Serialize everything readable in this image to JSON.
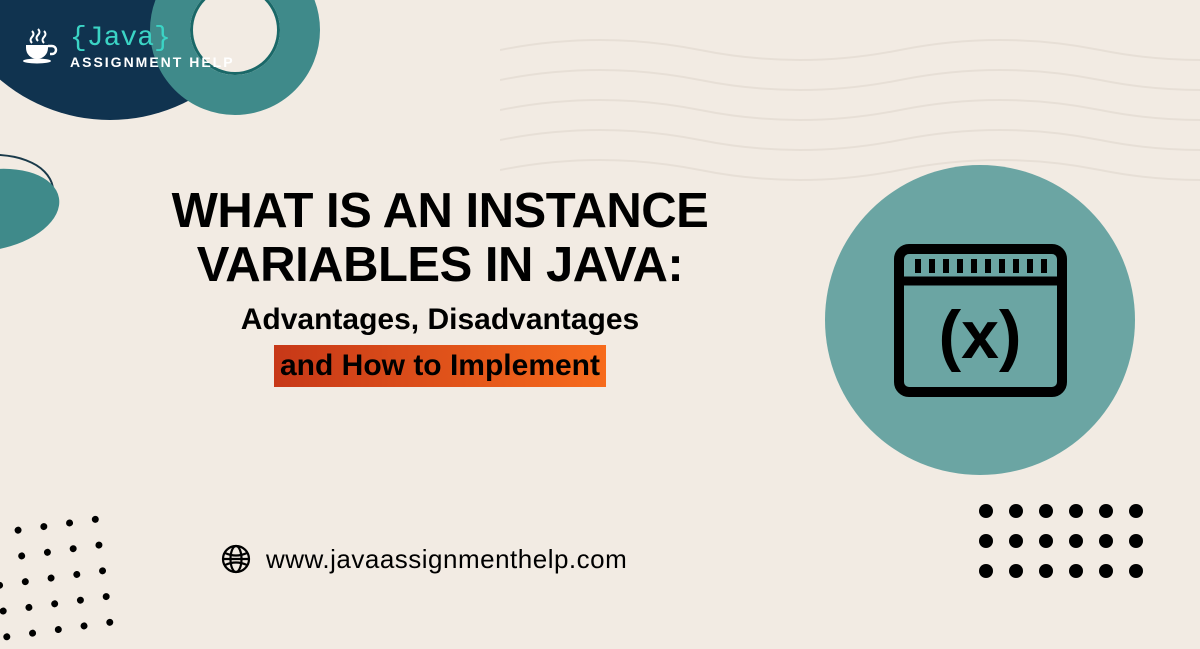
{
  "logo": {
    "name": "{Java}",
    "tagline": "ASSIGNMENT HELP"
  },
  "heading": {
    "line1": "WHAT IS AN INSTANCE",
    "line2": "VARIABLES IN JAVA:",
    "sub": "Advantages, Disadvantages",
    "highlight": "and How to Implement"
  },
  "website": {
    "url": "www.javaassignmenthelp.com"
  },
  "icons": {
    "cup": "coffee-cup-icon",
    "globe": "globe-icon",
    "window": "variable-window-icon"
  },
  "colors": {
    "bg": "#f2ebe3",
    "dark_navy": "#10334f",
    "teal": "#3f8a8a",
    "muted_teal": "#6ba5a3",
    "orange_grad_start": "#c73818",
    "orange_grad_end": "#f76b1c",
    "logo_accent": "#3bd4c5"
  }
}
